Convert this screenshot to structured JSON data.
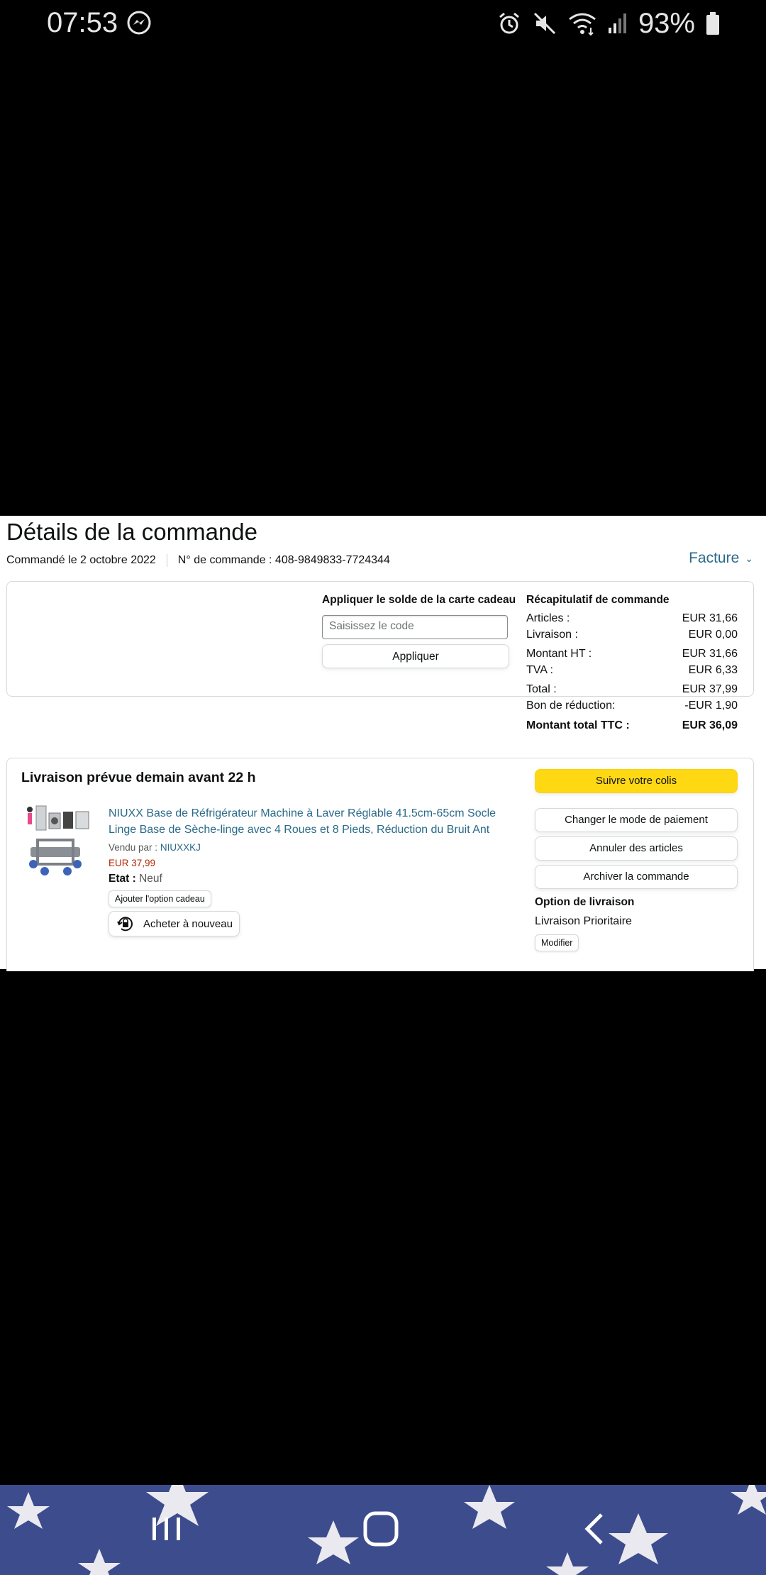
{
  "status_bar": {
    "time": "07:53",
    "battery": "93%",
    "icons": [
      "messenger-icon",
      "alarm-icon",
      "mute-icon",
      "wifi-icon",
      "signal-icon",
      "battery-icon"
    ]
  },
  "page": {
    "title": "Détails de la commande",
    "ordered_on": "Commandé le 2 octobre 2022",
    "order_number": "N° de commande : 408-9849833-7724344",
    "invoice": "Facture"
  },
  "gift_card": {
    "label": "Appliquer le solde de la carte cadeau",
    "placeholder": "Saisissez le code",
    "button": "Appliquer"
  },
  "summary": {
    "title": "Récapitulatif de commande",
    "rows": [
      {
        "label": "Articles :",
        "value": "EUR 31,66"
      },
      {
        "label": "Livraison :",
        "value": "EUR 0,00"
      },
      {
        "label": "Montant HT :",
        "value": "EUR 31,66"
      },
      {
        "label": "TVA :",
        "value": "EUR 6,33"
      },
      {
        "label": "Total :",
        "value": "EUR 37,99"
      },
      {
        "label": "Bon de réduction:",
        "value": "-EUR 1,90"
      },
      {
        "label": "Montant total TTC :",
        "value": "EUR 36,09"
      }
    ]
  },
  "shipment": {
    "title": "Livraison prévue demain avant 22 h",
    "product": {
      "name": "NIUXX Base de Réfrigérateur Machine à Laver Réglable 41.5cm-65cm Socle Linge Base de Sèche-linge avec 4 Roues et 8 Pieds, Réduction du Bruit Ant",
      "sold_by_label": "Vendu par :",
      "seller": "NIUXXKJ",
      "price": "EUR 37,99",
      "condition_label": "Etat :",
      "condition": "Neuf",
      "gift_option": "Ajouter l'option cadeau",
      "buy_again": "Acheter à nouveau"
    },
    "actions": {
      "track": "Suivre votre colis",
      "change_payment": "Changer le mode de paiement",
      "cancel_items": "Annuler des articles",
      "archive": "Archiver la commande"
    },
    "delivery_option": {
      "title": "Option de livraison",
      "value": "Livraison Prioritaire",
      "modify": "Modifier"
    }
  },
  "colors": {
    "link": "#2a6a8a",
    "price": "#b12704",
    "primary_button": "#ffd814",
    "nav_background": "#3b4a8a"
  }
}
